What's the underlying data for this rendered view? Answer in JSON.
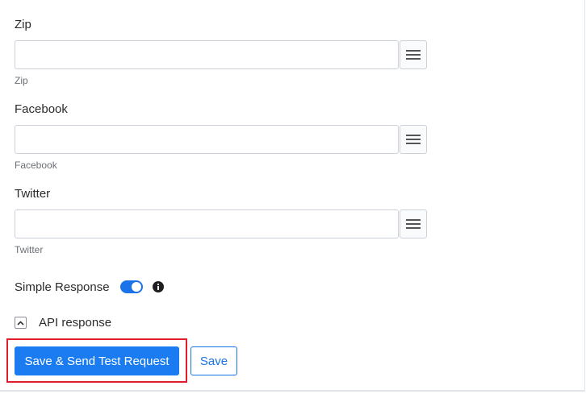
{
  "fields": [
    {
      "label": "Zip",
      "value": "",
      "help": "Zip"
    },
    {
      "label": "Facebook",
      "value": "",
      "help": "Facebook"
    },
    {
      "label": "Twitter",
      "value": "",
      "help": "Twitter"
    }
  ],
  "simple_response": {
    "label": "Simple Response",
    "enabled": true
  },
  "api_response": {
    "label": "API response",
    "expanded": true
  },
  "buttons": {
    "save_send": "Save & Send Test Request",
    "save": "Save"
  },
  "colors": {
    "primary": "#1a7cf0",
    "highlight": "#e11d2b",
    "toggle_on": "#1a73e8"
  },
  "icons": {
    "field_menu": "hamburger-menu-icon",
    "info": "info-icon",
    "collapse": "chevron-up-icon"
  }
}
